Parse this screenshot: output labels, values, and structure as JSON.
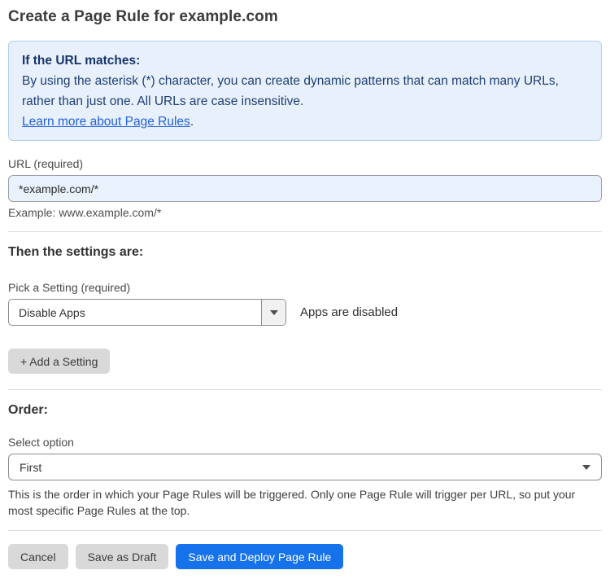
{
  "page": {
    "title": "Create a Page Rule for example.com"
  },
  "info_box": {
    "heading": "If the URL matches:",
    "body": "By using the asterisk (*) character, you can create dynamic patterns that can match many URLs, rather than just one. All URLs are case insensitive.",
    "link_label": "Learn more about Page Rules",
    "link_suffix": "."
  },
  "url_field": {
    "label": "URL (required)",
    "value": "*example.com/*",
    "helper": "Example: www.example.com/*"
  },
  "settings_section": {
    "heading": "Then the settings are:",
    "setting_label": "Pick a Setting (required)",
    "setting_value": "Disable Apps",
    "setting_status": "Apps are disabled",
    "add_setting_label": "+ Add a Setting"
  },
  "order_section": {
    "heading": "Order:",
    "label": "Select option",
    "value": "First",
    "helper": "This is the order in which your Page Rules will be triggered. Only one Page Rule will trigger per URL, so put your most specific Page Rules at the top."
  },
  "footer": {
    "cancel_label": "Cancel",
    "save_draft_label": "Save as Draft",
    "save_deploy_label": "Save and Deploy Page Rule"
  },
  "colors": {
    "accent_blue": "#1672eb",
    "info_bg": "#e8f1fb",
    "info_border": "#b3cfee",
    "info_text": "#1f3e75",
    "link_blue": "#2362d8",
    "input_bg_blue": "#e9f1fc",
    "button_gray": "#d9d9d9"
  }
}
